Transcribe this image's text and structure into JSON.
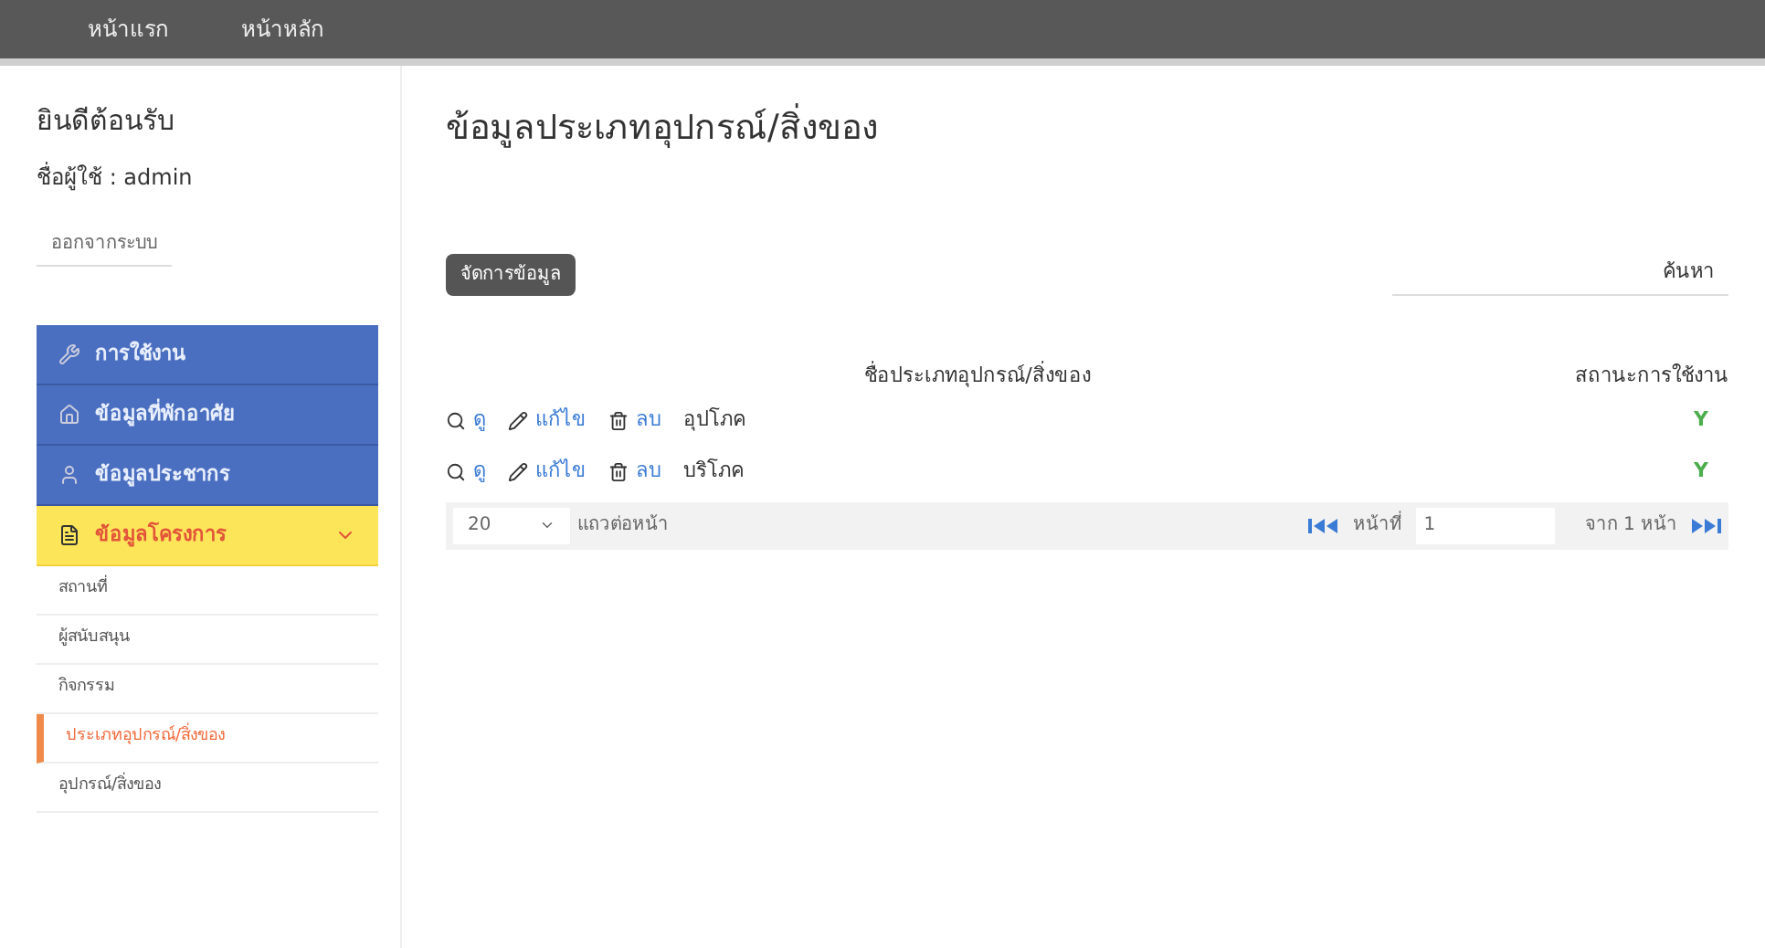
{
  "navbar": {
    "links": [
      "หน้าแรก",
      "หน้าหลัก"
    ]
  },
  "sidebar": {
    "welcome": "ยินดีต้อนรับ",
    "user": "ชื่อผู้ใช้ : admin",
    "logout": "ออกจากระบบ",
    "menu": [
      {
        "label": "การใช้งาน",
        "selected": false
      },
      {
        "label": "ข้อมูลที่พักอาศัย",
        "selected": false
      },
      {
        "label": "ข้อมูลประชากร",
        "selected": false
      },
      {
        "label": "ข้อมูลโครงการ",
        "selected": true,
        "expanded": true,
        "children": [
          {
            "label": "สถานที่",
            "selected": false
          },
          {
            "label": "ผู้สนับสนุน",
            "selected": false
          },
          {
            "label": "กิจกรรม",
            "selected": false
          },
          {
            "label": "ประเภทอุปกรณ์/สิ่งของ",
            "selected": true
          },
          {
            "label": "อุปกรณ์/สิ่งของ",
            "selected": false
          }
        ]
      }
    ]
  },
  "main": {
    "title": "ข้อมูลประเภทอุปกรณ์/สิ่งของ",
    "manage_button": "จัดการข้อมูล",
    "search_button": "ค้นหา",
    "table": {
      "columns": [
        "ชื่อประเภทอุปกรณ์/สิ่งของ",
        "สถานะการใช้งาน"
      ],
      "rows": [
        {
          "view": "ดู",
          "edit": "แก้ไข",
          "delete": "ลบ",
          "name": "อุปโภค",
          "status": "Y"
        },
        {
          "view": "ดู",
          "edit": "แก้ไข",
          "delete": "ลบ",
          "name": "บริโภค",
          "status": "Y"
        }
      ]
    },
    "pager": {
      "page_size": "20",
      "page_size_label": "แถวต่อหน้า",
      "page_label": "หน้าที่",
      "page": "1",
      "total_label": "จาก 1 หน้า"
    }
  }
}
